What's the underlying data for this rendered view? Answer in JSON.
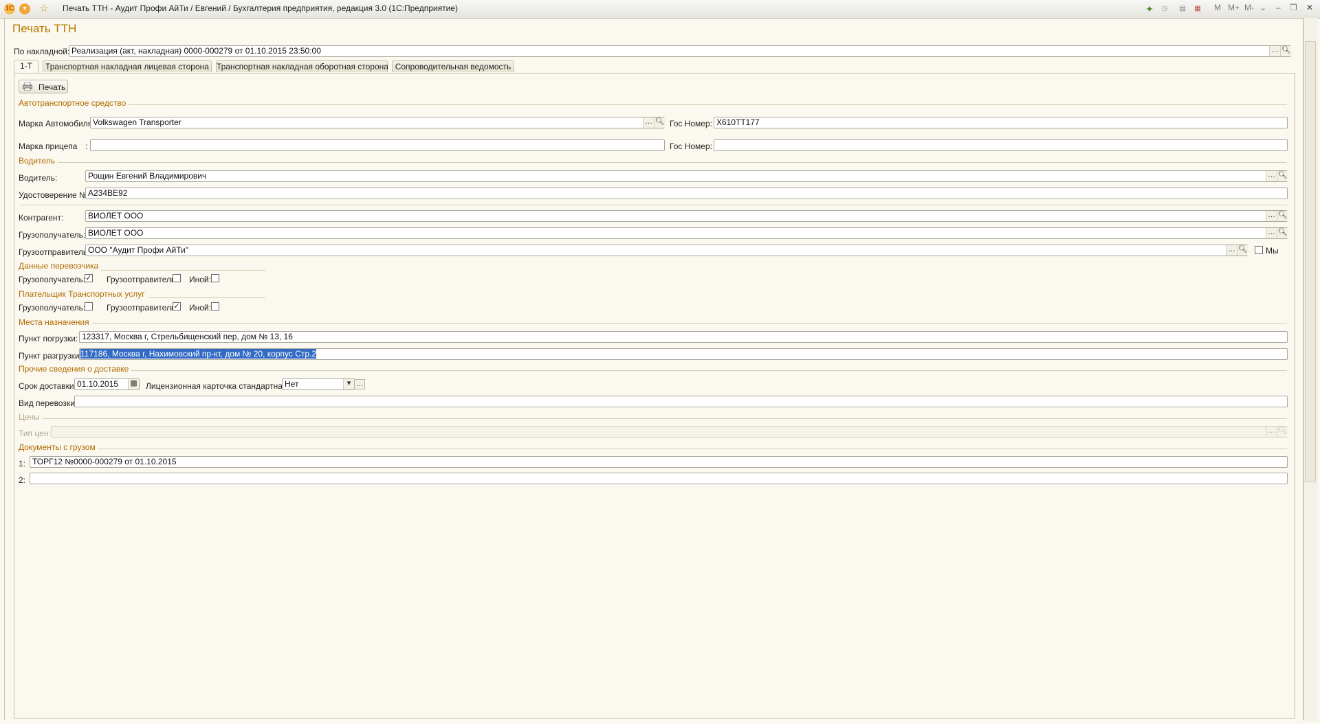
{
  "window": {
    "title": "Печать ТТН - Аудит Профи АйТи / Евгений / Бухгалтерия предприятия, редакция 3.0  (1С:Предприятие)",
    "right_labels": [
      "M",
      "M+",
      "M-"
    ]
  },
  "form": {
    "title": "Печать ТТН",
    "invoice_label": "По накладной:",
    "invoice_value": "Реализация (акт, накладная) 0000-000279 от 01.10.2015 23:50:00",
    "tabs": [
      {
        "label": "1-Т",
        "active": true
      },
      {
        "label": "Транспортная накладная лицевая сторона",
        "active": false
      },
      {
        "label": "Транспортная накладная оборотная сторона",
        "active": false
      },
      {
        "label": "Сопроводительная ведомость",
        "active": false
      }
    ],
    "print_button": "Печать"
  },
  "vehicle": {
    "section": "Автотранспортное средство",
    "car_label": "Марка Автомобиля:",
    "car_value": "Volkswagen Transporter",
    "plate_label": "Гос Номер:",
    "plate_value": "Х610ТТ177",
    "trailer_label": "Марка прицепа",
    "trailer_colon": ":",
    "trailer_value": "",
    "trailer_plate_label": "Гос Номер:",
    "trailer_plate_value": ""
  },
  "driver": {
    "section": "Водитель",
    "driver_label": "Водитель:",
    "driver_value": "Рощин Евгений Владимирович",
    "license_label": "Удостоверение №:",
    "license_value": "А234ВЕ92"
  },
  "parties": {
    "contractor_label": "Контрагент:",
    "contractor_value": "ВИОЛЕТ ООО",
    "consignee_label": "Грузополучатель:",
    "consignee_value": "ВИОЛЕТ ООО",
    "shipper_label": "Грузоотправитель:",
    "shipper_value": "ООО \"Аудит Профи АйТи\"",
    "we_label": "Мы",
    "we_checked": false
  },
  "carrier": {
    "section": "Данные перевозчика",
    "consignee_label": "Грузополучатель:",
    "consignee_checked": true,
    "shipper_label": "Грузоотправитель:",
    "shipper_checked": false,
    "other_label": "Иной:",
    "other_checked": false
  },
  "payer": {
    "section": "Плательщик Транспортных услуг",
    "consignee_label": "Грузополучатель:",
    "consignee_checked": false,
    "shipper_label": "Грузоотправитель:",
    "shipper_checked": true,
    "other_label": "Иной:",
    "other_checked": false
  },
  "destination": {
    "section": "Места назначения",
    "loading_label": "Пункт погрузки:",
    "loading_value": "123317, Москва г, Стрельбищенский пер, дом № 13, 16",
    "unloading_label": "Пункт разгрузки:",
    "unloading_value": "117186, Москва г, Нахимовский пр-кт, дом № 20, корпус Стр.2"
  },
  "delivery": {
    "section": "Прочие сведения о доставке",
    "term_label": "Срок доставки:",
    "term_value": "01.10.2015",
    "license_card_label": "Лицензионная карточка стандартная:",
    "license_card_value": "Нет",
    "transport_type_label": "Вид перевозки:",
    "transport_type_value": ""
  },
  "prices": {
    "section": "Цены",
    "type_label": "Тип цен:",
    "type_value": ""
  },
  "documents": {
    "section": "Документы с грузом",
    "rows": [
      {
        "num": "1:",
        "value": "ТОРГ12 №0000-000279 от 01.10.2015"
      },
      {
        "num": "2:",
        "value": ""
      }
    ]
  }
}
